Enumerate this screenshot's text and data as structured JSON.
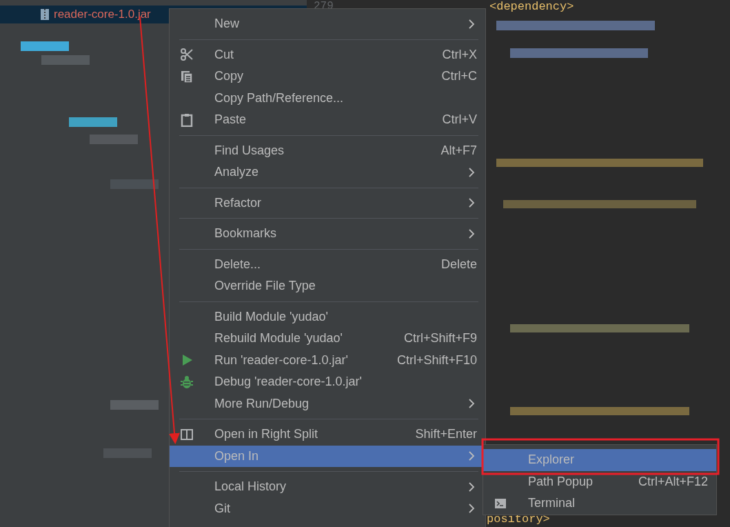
{
  "project_tree": {
    "selected_file": "reader-core-1.0.jar"
  },
  "editor": {
    "line_number": "279",
    "top_line": "<dependency>",
    "bottom_line": "pository>"
  },
  "context_menu": {
    "items": [
      {
        "kind": "item",
        "label": "New",
        "submenu": true,
        "selected": false
      },
      {
        "kind": "separator"
      },
      {
        "kind": "item",
        "label": "Cut",
        "shortcut": "Ctrl+X",
        "selected": false
      },
      {
        "kind": "item",
        "label": "Copy",
        "shortcut": "Ctrl+C",
        "selected": false
      },
      {
        "kind": "item",
        "label": "Copy Path/Reference...",
        "selected": false
      },
      {
        "kind": "item",
        "label": "Paste",
        "shortcut": "Ctrl+V",
        "selected": false
      },
      {
        "kind": "separator"
      },
      {
        "kind": "item",
        "label": "Find Usages",
        "shortcut": "Alt+F7",
        "selected": false
      },
      {
        "kind": "item",
        "label": "Analyze",
        "submenu": true,
        "selected": false
      },
      {
        "kind": "separator"
      },
      {
        "kind": "item",
        "label": "Refactor",
        "submenu": true,
        "selected": false
      },
      {
        "kind": "separator"
      },
      {
        "kind": "item",
        "label": "Bookmarks",
        "submenu": true,
        "selected": false
      },
      {
        "kind": "separator"
      },
      {
        "kind": "item",
        "label": "Delete...",
        "shortcut": "Delete",
        "selected": false
      },
      {
        "kind": "item",
        "label": "Override File Type",
        "selected": false
      },
      {
        "kind": "separator"
      },
      {
        "kind": "item",
        "label": "Build Module 'yudao'",
        "selected": false
      },
      {
        "kind": "item",
        "label": "Rebuild Module 'yudao'",
        "shortcut": "Ctrl+Shift+F9",
        "selected": false
      },
      {
        "kind": "item",
        "label": "Run 'reader-core-1.0.jar'",
        "shortcut": "Ctrl+Shift+F10",
        "selected": false
      },
      {
        "kind": "item",
        "label": "Debug 'reader-core-1.0.jar'",
        "selected": false
      },
      {
        "kind": "item",
        "label": "More Run/Debug",
        "submenu": true,
        "selected": false
      },
      {
        "kind": "separator"
      },
      {
        "kind": "item",
        "label": "Open in Right Split",
        "shortcut": "Shift+Enter",
        "selected": false
      },
      {
        "kind": "item",
        "label": "Open In",
        "submenu": true,
        "selected": true
      },
      {
        "kind": "separator"
      },
      {
        "kind": "item",
        "label": "Local History",
        "submenu": true,
        "selected": false
      },
      {
        "kind": "item",
        "label": "Git",
        "submenu": true,
        "selected": false
      }
    ]
  },
  "submenu": {
    "items": [
      {
        "kind": "item",
        "label": "Explorer",
        "selected": true
      },
      {
        "kind": "item",
        "label": "Path Popup",
        "shortcut": "Ctrl+Alt+F12",
        "selected": false
      },
      {
        "kind": "item",
        "label": "Terminal",
        "selected": false
      }
    ]
  }
}
